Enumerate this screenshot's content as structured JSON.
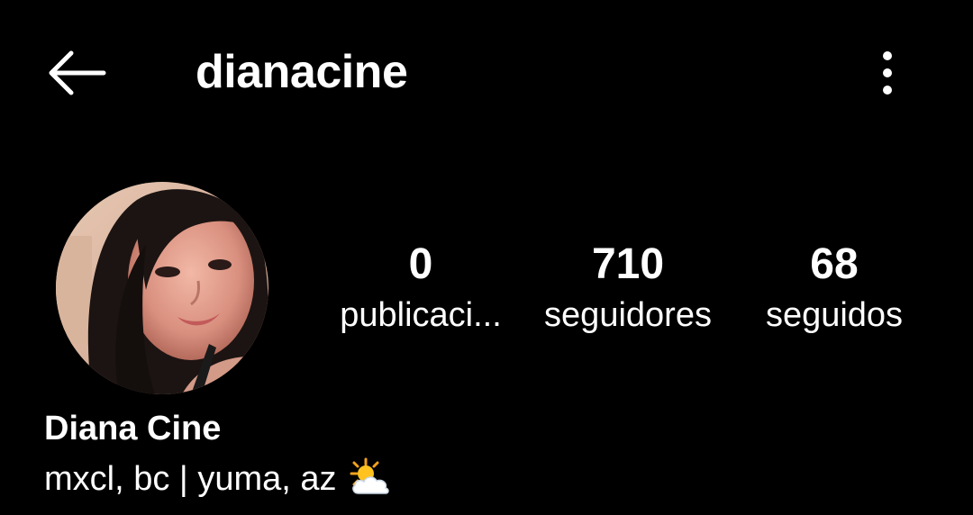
{
  "header": {
    "username": "dianacine",
    "back_icon": "arrow-left-icon",
    "more_icon": "more-vertical-icon"
  },
  "profile": {
    "avatar_alt": "Profile photo",
    "display_name": "Diana Cine",
    "bio_text": "mxcl, bc | yuma, az",
    "bio_emoji": "sun-behind-cloud-icon"
  },
  "stats": {
    "posts": {
      "value": "0",
      "label": "publicaci..."
    },
    "followers": {
      "value": "710",
      "label": "seguidores"
    },
    "following": {
      "value": "68",
      "label": "seguidos"
    }
  },
  "colors": {
    "background": "#000000",
    "text": "#ffffff"
  }
}
